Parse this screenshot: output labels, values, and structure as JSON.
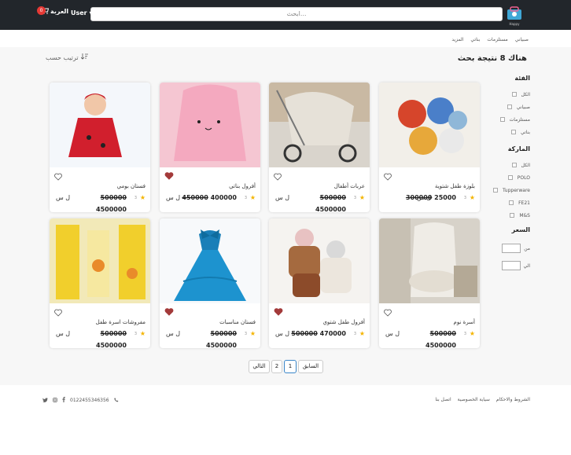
{
  "header": {
    "search_placeholder": "ابحث...",
    "cart_label": "العربة",
    "cart_count": "0",
    "user_label": "User",
    "logo_text": "Happy"
  },
  "nav": {
    "items": [
      "صبياني",
      "مستلزمات",
      "بناتي",
      "المزيد"
    ]
  },
  "results": {
    "title": "هناك 8 نتيجة بحث",
    "sort_label": "ترتيب حسب"
  },
  "filters": {
    "category": {
      "title": "الفئة",
      "items": [
        "الكل",
        "صبياني",
        "مستلزمات",
        "بناتي"
      ]
    },
    "brand": {
      "title": "الماركة",
      "items": [
        "الكل",
        "POLO",
        "Tupperware",
        "FE21",
        "M&S"
      ]
    },
    "price": {
      "title": "السعر",
      "from": "من",
      "to": "الي"
    }
  },
  "products": [
    {
      "name": "بلوزة طفل شتوية",
      "rating": "3",
      "old_price": "300000",
      "new_price": "25000",
      "currency": "ل س",
      "favorite": false
    },
    {
      "name": "عربات أطفال",
      "rating": "3",
      "old_price": "500000",
      "new_price": "4500000",
      "currency": "ل س",
      "favorite": false
    },
    {
      "name": "أفرول بناتي",
      "rating": "3",
      "old_price": "450000",
      "new_price": "400000",
      "currency": "ل س",
      "favorite": true
    },
    {
      "name": "فستان بومي",
      "rating": "3",
      "old_price": "500000",
      "new_price": "4500000",
      "currency": "ل س",
      "favorite": false
    },
    {
      "name": "أسرة نوم",
      "rating": "3",
      "old_price": "500000",
      "new_price": "4500000",
      "currency": "ل س",
      "favorite": false
    },
    {
      "name": "أفرول طفل شتوي",
      "rating": "3",
      "old_price": "500000",
      "new_price": "470000",
      "currency": "ل س",
      "favorite": true
    },
    {
      "name": "فستان مناسبات",
      "rating": "3",
      "old_price": "500000",
      "new_price": "4500000",
      "currency": "ل س",
      "favorite": true
    },
    {
      "name": "مفروشات اسرة طفل",
      "rating": "3",
      "old_price": "500000",
      "new_price": "4500000",
      "currency": "ل س",
      "favorite": false
    }
  ],
  "pagination": {
    "prev": "السابق",
    "pages": [
      "1",
      "2"
    ],
    "next": "التالي"
  },
  "footer": {
    "links": [
      "الشروط والاحكام",
      "سياية الخصوصية",
      "اتصل بنا"
    ],
    "phone": "0122455346356"
  },
  "colors": {
    "topbar": "#22262b",
    "star": "#f4b400",
    "badge": "#e53935",
    "heart_active": "#a33a3a"
  }
}
